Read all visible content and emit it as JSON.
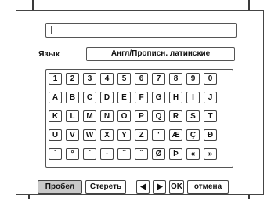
{
  "screen": {
    "text_field": {
      "value": ""
    },
    "language": {
      "label": "Язык",
      "value": "Англ/Прописн. латинские"
    },
    "keyboard": {
      "rows": [
        [
          "1",
          "2",
          "3",
          "4",
          "5",
          "6",
          "7",
          "8",
          "9",
          "0"
        ],
        [
          "A",
          "B",
          "C",
          "D",
          "E",
          "F",
          "G",
          "H",
          "I",
          "J"
        ],
        [
          "K",
          "L",
          "M",
          "N",
          "O",
          "P",
          "Q",
          "R",
          "S",
          "T"
        ],
        [
          "U",
          "V",
          "W",
          "X",
          "Y",
          "Z",
          "'",
          "Æ",
          "Ç",
          "Đ"
        ],
        [
          "´",
          "°",
          "`",
          "-",
          "˜",
          "ˆ",
          "Ø",
          "Þ",
          "«",
          "»"
        ]
      ]
    },
    "bottom_bar": {
      "space_label": "Пробел",
      "delete_label": "Стереть",
      "left_arrow_icon": "left-triangle-arrow",
      "right_arrow_icon": "right-triangle-arrow",
      "ok_label": "OK",
      "cancel_label": "отмена",
      "selected": "space"
    },
    "colors": {
      "selected_button_bg": "#c9c9c9",
      "border": "#444444"
    }
  }
}
